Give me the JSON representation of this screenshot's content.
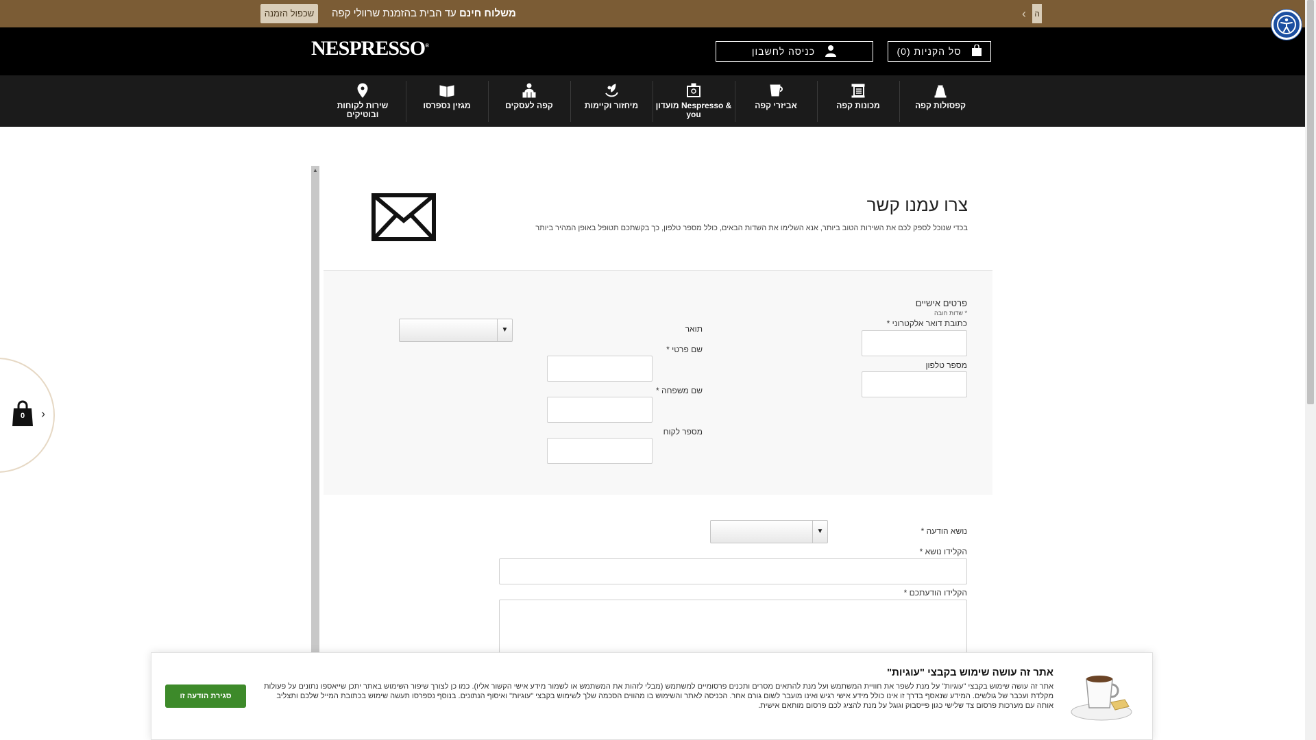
{
  "promo": {
    "text_bold": "משלוח חינם",
    "text_rest": " עד הבית בהזמנת שרוולי קפה",
    "reorder_label": "שכפול הזמנה",
    "edge_label": "ה"
  },
  "header": {
    "logo": "NESPRESSO",
    "logo_mark": "®",
    "account_label": "כניסה לחשבון",
    "cart_label": "סל הקניות (0)"
  },
  "nav": {
    "items": [
      {
        "label": "קפסולות קפה",
        "icon": "capsule-icon"
      },
      {
        "label": "מכונות קפה",
        "icon": "coffee-machine-icon"
      },
      {
        "label": "אביזרי קפה",
        "icon": "cup-icon"
      },
      {
        "label": "מועדון Nespresso & you",
        "icon": "club-icon"
      },
      {
        "label": "מיחזור וקיימות",
        "icon": "recycle-icon"
      },
      {
        "label": "קפה לעסקים",
        "icon": "business-icon"
      },
      {
        "label": "מגזין נספרסו",
        "icon": "magazine-icon"
      },
      {
        "label": "שירות לקוחות ובוטיקים",
        "icon": "location-icon"
      }
    ]
  },
  "contact": {
    "title": "צרו עמנו קשר",
    "subtitle": "בכדי שנוכל לספק לכם את השירות הטוב ביותר, אנא השלימו את השדות הבאים, כולל מספר טלפון, כך בקשתכם תטופל באופן המהיר ביותר",
    "personal_heading": "פרטים אישיים",
    "required_note": "* שדות חובה",
    "email_label": "כתובת דואר אלקטרוני *",
    "phone_label": "מספר טלפון",
    "title_label": "תואר",
    "first_name_label": "שם פרטי *",
    "last_name_label": "שם משפחה *",
    "customer_no_label": "מספר לקוח",
    "subject_label": "נושא הודעה *",
    "subject_text_label": "הקלידו נושא *",
    "message_label": "הקלידו הודעתכם *"
  },
  "side_cart": {
    "count": "0"
  },
  "cookie": {
    "title": "אתר זה עושה שימוש בקבצי \"עוגיות\"",
    "text": "אתר זה עושה שימוש בקבצי \"עוגיות\" על מנת לשפר את חוויית המשתמש ועל מנת להתאים מסרים ותכנים פרסומיים למשתמש (מבלי לזהות את המשתמש או לשמור מידע אישי הקשור אליו). כמו כן לצורך שיפור השימוש באתר יתכן שייאספו נתונים על פעולות מקלדת ועכבר של גולשים. המידע שנאסף בדרך זו אינו כולל מידע אישי רגיש ואינו מועבר לשום גורם אחר. הכניסה לאתר והשימוש בו מהווים הסכמה שלך לשימוש בקבצי \"עוגיות\" ואיסוף הנתונים. בנוסף נספרסו תעשה שימוש בכתובת המייל שלכם ותצליב אותה עם מערכות פרסום צד שלישי כגון פייסבוק וגוגל על מנת להציג לכם פרסום מותאם אישית.",
    "accept_label": "סגירת הודעה זו"
  },
  "colors": {
    "promo_bg": "#7b5c35",
    "header_bg": "#000000",
    "nav_bg": "#1b1b1b",
    "accept_green": "#3d8a2a",
    "a11y_blue": "#1c4fa1"
  }
}
